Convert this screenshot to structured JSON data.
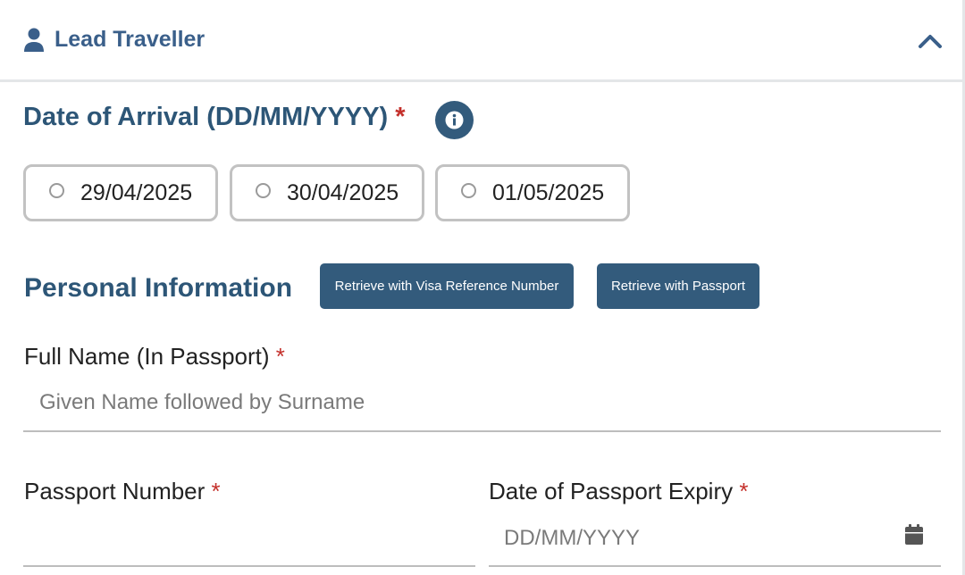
{
  "header": {
    "title": "Lead Traveller",
    "icon": "user-icon",
    "collapse_icon": "chevron-up-icon"
  },
  "arrival": {
    "title": "Date of Arrival (DD/MM/YYYY)",
    "required_mark": "*",
    "info_icon": "info-icon",
    "options": [
      {
        "label": "29/04/2025",
        "selected": false
      },
      {
        "label": "30/04/2025",
        "selected": false
      },
      {
        "label": "01/05/2025",
        "selected": false
      }
    ]
  },
  "personal": {
    "title": "Personal Information",
    "retrieve_visa_label": "Retrieve with Visa Reference Number",
    "retrieve_passport_label": "Retrieve with Passport"
  },
  "full_name": {
    "label": "Full Name (In Passport)",
    "required_mark": "*",
    "placeholder": "Given Name followed by Surname",
    "value": ""
  },
  "passport_number": {
    "label": "Passport Number",
    "required_mark": "*",
    "value": ""
  },
  "passport_expiry": {
    "label": "Date of Passport Expiry",
    "required_mark": "*",
    "placeholder": "DD/MM/YYYY",
    "icon": "calendar-icon"
  },
  "colors": {
    "primary": "#335b7c",
    "heading": "#2d5677",
    "required": "#c4302b"
  }
}
